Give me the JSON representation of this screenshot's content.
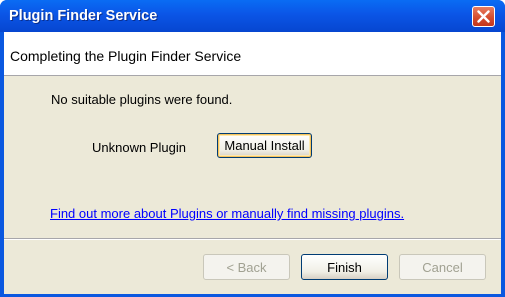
{
  "window": {
    "title": "Plugin Finder Service"
  },
  "header": {
    "title": "Completing the Plugin Finder Service"
  },
  "body": {
    "message": "No suitable plugins were found.",
    "plugin_name": "Unknown Plugin",
    "manual_install_label": "Manual Install",
    "help_link": "Find out more about Plugins or manually find missing plugins."
  },
  "footer": {
    "back_label": "< Back",
    "finish_label": "Finish",
    "cancel_label": "Cancel",
    "back_enabled": false,
    "cancel_enabled": false
  },
  "colors": {
    "titlebar": "#0b55e6",
    "dialog_bg": "#ece9d8",
    "link": "#0000ff",
    "close_button": "#d34a2c"
  },
  "icons": {
    "close": "close-x-icon"
  }
}
